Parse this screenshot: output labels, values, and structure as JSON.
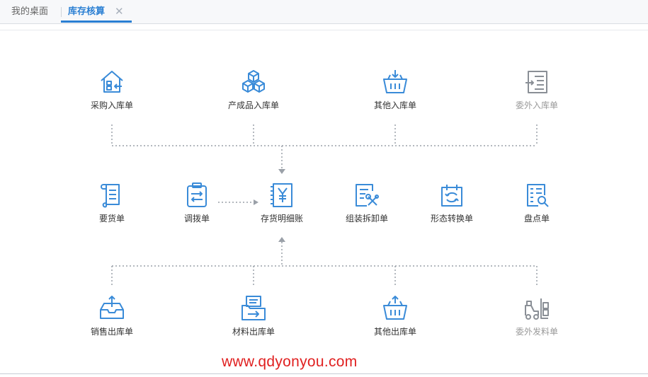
{
  "tabs": {
    "home_label": "我的桌面",
    "active_label": "库存核算",
    "close_symbol": "✕"
  },
  "colors": {
    "accent": "#2a7fd3",
    "icon_blue": "#3a8bd8",
    "icon_gray": "#8a8f96",
    "connector": "#9aa0a8"
  },
  "inbound": [
    {
      "label": "采购入库单",
      "icon": "warehouse-in-icon",
      "enabled": true
    },
    {
      "label": "产成品入库单",
      "icon": "boxes-icon",
      "enabled": true
    },
    {
      "label": "其他入库单",
      "icon": "basket-in-icon",
      "enabled": true
    },
    {
      "label": "委外入库单",
      "icon": "list-in-icon",
      "enabled": false
    }
  ],
  "middle": [
    {
      "label": "要货单",
      "icon": "scroll-icon",
      "enabled": true
    },
    {
      "label": "调拨单",
      "icon": "clipboard-transfer-icon",
      "enabled": true
    },
    {
      "label": "存货明细账",
      "icon": "ledger-yen-icon",
      "enabled": true
    },
    {
      "label": "组装拆卸单",
      "icon": "tools-doc-icon",
      "enabled": true
    },
    {
      "label": "形态转换单",
      "icon": "convert-doc-icon",
      "enabled": true
    },
    {
      "label": "盘点单",
      "icon": "inventory-search-icon",
      "enabled": true
    }
  ],
  "outbound": [
    {
      "label": "销售出库单",
      "icon": "tray-out-icon",
      "enabled": true
    },
    {
      "label": "材料出库单",
      "icon": "folder-out-icon",
      "enabled": true
    },
    {
      "label": "其他出库单",
      "icon": "basket-out-icon",
      "enabled": true
    },
    {
      "label": "委外发料单",
      "icon": "forklift-icon",
      "enabled": false
    }
  ],
  "watermark": "www.qdyonyou.com"
}
